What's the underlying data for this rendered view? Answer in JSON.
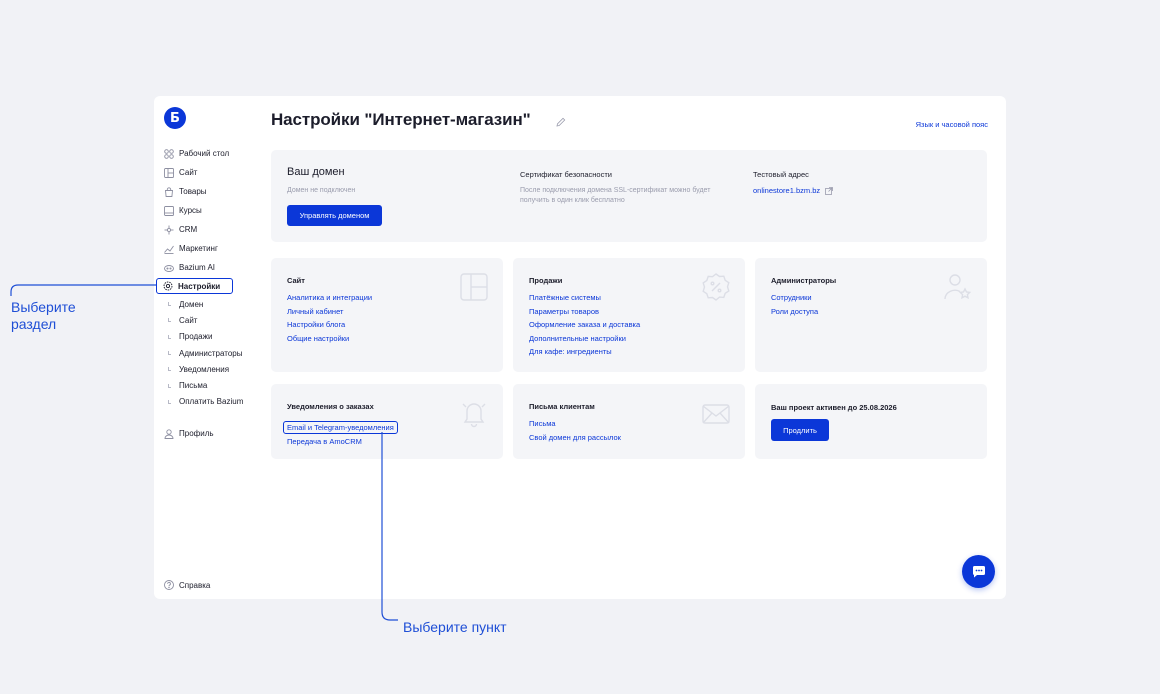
{
  "logo": {
    "letter": "Б"
  },
  "nav": {
    "items": [
      {
        "label": "Рабочий стол",
        "icon": "dashboard-icon"
      },
      {
        "label": "Сайт",
        "icon": "layout-icon"
      },
      {
        "label": "Товары",
        "icon": "bag-icon"
      },
      {
        "label": "Курсы",
        "icon": "book-icon"
      },
      {
        "label": "CRM",
        "icon": "crm-icon"
      },
      {
        "label": "Маркетинг",
        "icon": "chart-icon"
      },
      {
        "label": "Bazium AI",
        "icon": "ai-icon"
      }
    ],
    "active": {
      "label": "Настройки",
      "icon": "gear-icon"
    },
    "subitems": [
      "Домен",
      "Сайт",
      "Продажи",
      "Администраторы",
      "Уведомления",
      "Письма",
      "Оплатить Bazium"
    ],
    "profile": "Профиль",
    "help": "Справка"
  },
  "header": {
    "title": "Настройки \"Интернет-магазин\"",
    "lang_link": "Язык и часовой пояс"
  },
  "domain": {
    "title": "Ваш домен",
    "subtitle": "Домен не подключен",
    "button": "Управлять доменом",
    "ssl_title": "Сертификат безопасности",
    "ssl_text": "После подключения домена SSL-сертификат можно будет получить в один клик бесплатно",
    "test_title": "Тестовый адрес",
    "test_link": "onlinestore1.bzm.bz"
  },
  "cards": {
    "site": {
      "title": "Сайт",
      "links": [
        "Аналитика и интеграции",
        "Личный кабинет",
        "Настройки блога",
        "Общие настройки"
      ]
    },
    "sales": {
      "title": "Продажи",
      "links": [
        "Платёжные системы",
        "Параметры товаров",
        "Оформление заказа и доставка",
        "Дополнительные настройки",
        "Для кафе: ингредиенты"
      ]
    },
    "admins": {
      "title": "Администраторы",
      "links": [
        "Сотрудники",
        "Роли доступа"
      ]
    },
    "notifications": {
      "title": "Уведомления о заказах",
      "links": [
        "Email и Telegram-уведомления",
        "Передача в AmoCRM"
      ]
    },
    "letters": {
      "title": "Письма клиентам",
      "links": [
        "Письма",
        "Свой домен для рассылок"
      ]
    },
    "project": {
      "title": "Ваш проект активен до 25.08.2026",
      "button": "Продлить"
    }
  },
  "annotations": {
    "select_section": "Выберите раздел",
    "select_item": "Выберите пункт"
  },
  "colors": {
    "accent": "#0b37d8",
    "annotation": "#1f4fd6"
  }
}
